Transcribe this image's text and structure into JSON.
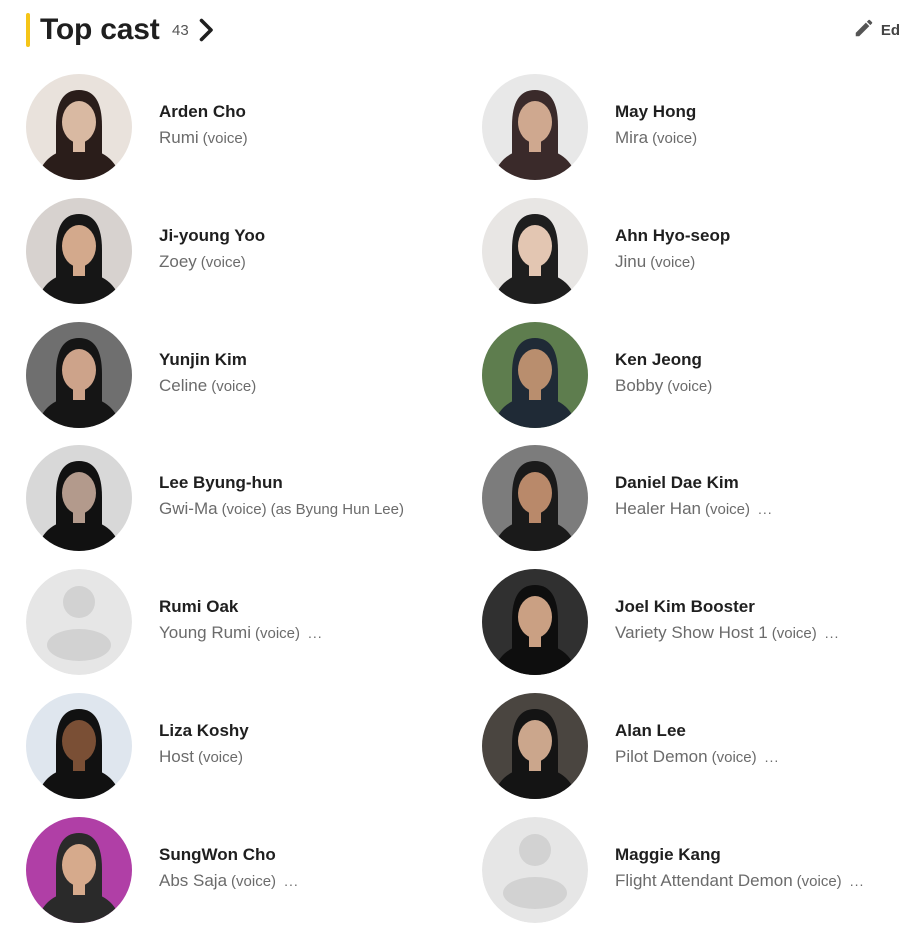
{
  "header": {
    "title": "Top cast",
    "count": "43",
    "chevron_icon": "chevron-right-icon",
    "edit_icon": "pencil-icon",
    "edit_label": "Ed"
  },
  "colors": {
    "accent": "#f5c518",
    "text_primary": "#1f1f1f",
    "text_secondary": "#6b6b6b",
    "placeholder_bg": "#e6e6e6",
    "placeholder_fg": "#d2d2d2"
  },
  "cast": [
    {
      "name": "Arden Cho",
      "character": "Rumi",
      "attributes": [
        "(voice)"
      ],
      "more": "",
      "photo": "photo"
    },
    {
      "name": "May Hong",
      "character": "Mira",
      "attributes": [
        "(voice)"
      ],
      "more": "",
      "photo": "photo"
    },
    {
      "name": "Ji-young Yoo",
      "character": "Zoey",
      "attributes": [
        "(voice)"
      ],
      "more": "",
      "photo": "photo"
    },
    {
      "name": "Ahn Hyo-seop",
      "character": "Jinu",
      "attributes": [
        "(voice)"
      ],
      "more": "",
      "photo": "photo"
    },
    {
      "name": "Yunjin Kim",
      "character": "Celine",
      "attributes": [
        "(voice)"
      ],
      "more": "",
      "photo": "photo"
    },
    {
      "name": "Ken Jeong",
      "character": "Bobby",
      "attributes": [
        "(voice)"
      ],
      "more": "",
      "photo": "photo"
    },
    {
      "name": "Lee Byung-hun",
      "character": "Gwi-Ma",
      "attributes": [
        "(voice)",
        "(as Byung Hun Lee)"
      ],
      "more": "",
      "photo": "photo"
    },
    {
      "name": "Daniel Dae Kim",
      "character": "Healer Han",
      "attributes": [
        "(voice)"
      ],
      "more": "...",
      "photo": "photo"
    },
    {
      "name": "Rumi Oak",
      "character": "Young Rumi",
      "attributes": [
        "(voice)"
      ],
      "more": "...",
      "photo": "placeholder"
    },
    {
      "name": "Joel Kim Booster",
      "character": "Variety Show Host 1",
      "attributes": [
        "(voice)"
      ],
      "more": "...",
      "photo": "photo"
    },
    {
      "name": "Liza Koshy",
      "character": "Host",
      "attributes": [
        "(voice)"
      ],
      "more": "",
      "photo": "photo"
    },
    {
      "name": "Alan Lee",
      "character": "Pilot Demon",
      "attributes": [
        "(voice)"
      ],
      "more": "...",
      "photo": "photo"
    },
    {
      "name": "SungWon Cho",
      "character": "Abs Saja",
      "attributes": [
        "(voice)"
      ],
      "more": "...",
      "photo": "photo"
    },
    {
      "name": "Maggie Kang",
      "character": "Flight Attendant Demon",
      "attributes": [
        "(voice)"
      ],
      "more": "...",
      "photo": "placeholder"
    }
  ]
}
